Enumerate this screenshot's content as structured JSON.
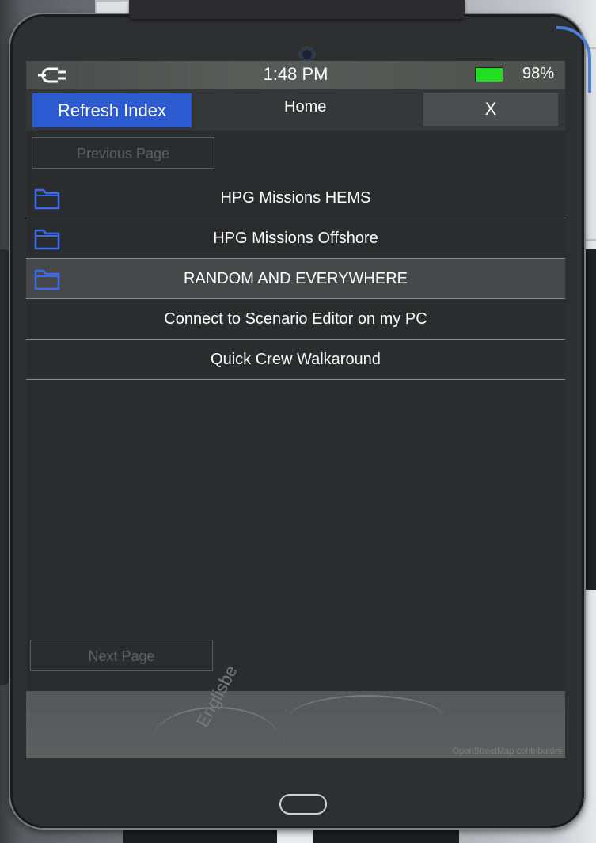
{
  "status_bar": {
    "time": "1:48 PM",
    "battery_percent": "98%",
    "battery_level": 0.98,
    "power_icon": "plug-icon",
    "battery_color": "#22dd22"
  },
  "top_bar": {
    "refresh_label": "Refresh Index",
    "title": "Home",
    "close_label": "X",
    "refresh_color": "#2c5ad1"
  },
  "pagination": {
    "previous_label": "Previous Page",
    "next_label": "Next Page"
  },
  "items": [
    {
      "label": "HPG Missions HEMS",
      "icon": "folder-icon",
      "selected": false
    },
    {
      "label": "HPG Missions Offshore",
      "icon": "folder-icon",
      "selected": false
    },
    {
      "label": "RANDOM AND EVERYWHERE",
      "icon": "folder-icon",
      "selected": true
    },
    {
      "label": "Connect to Scenario Editor on my PC",
      "icon": null,
      "selected": false
    },
    {
      "label": "Quick Crew Walkaround",
      "icon": null,
      "selected": false
    }
  ],
  "map": {
    "place_label": "Englisbe",
    "credit": "OpenStreetMap contributors"
  }
}
